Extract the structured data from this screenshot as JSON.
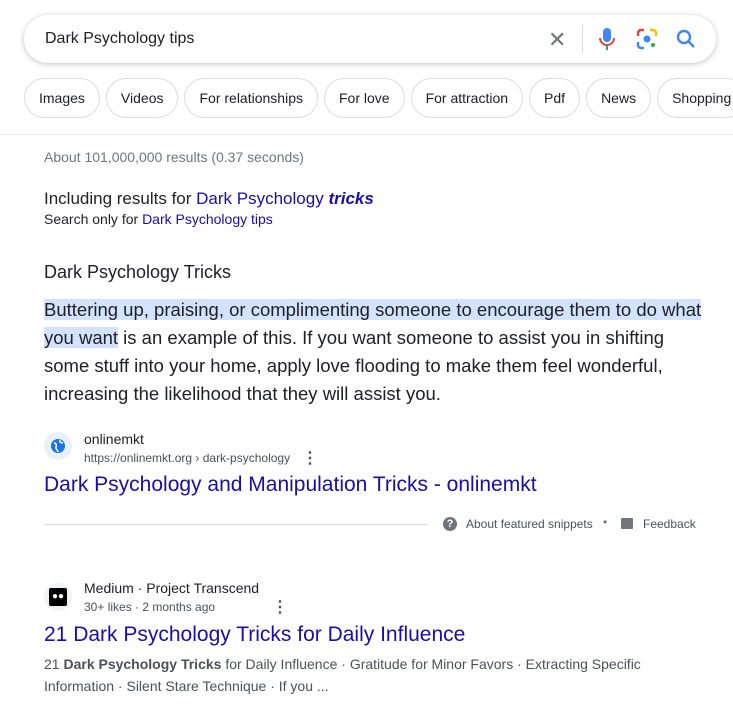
{
  "search": {
    "query": "Dark Psychology tips"
  },
  "chips": [
    "Images",
    "Videos",
    "For relationships",
    "For love",
    "For attraction",
    "Pdf",
    "News",
    "Shopping"
  ],
  "stats": "About 101,000,000 results (0.37 seconds)",
  "correction": {
    "including": "Including results for",
    "corrected_plain": "Dark Psychology",
    "corrected_bold": "tricks",
    "search_only": "Search only for",
    "original": "Dark Psychology tips"
  },
  "featured": {
    "heading": "Dark Psychology Tricks",
    "highlight": "Buttering up, praising, or complimenting someone to encourage them to do what you want",
    "rest": " is an example of this. If you want someone to assist you in shifting some stuff into your home, apply love flooding to make them feel wonderful, increasing the likelihood that they will assist you.",
    "site": "onlinemkt",
    "url": "https://onlinemkt.org › dark-psychology",
    "title": "Dark Psychology and Manipulation Tricks - onlinemkt",
    "about": "About featured snippets",
    "feedback": "Feedback"
  },
  "result2": {
    "site": "Medium · Project Transcend",
    "meta": "30+ likes · 2 months ago",
    "title": "21 Dark Psychology Tricks for Daily Influence",
    "snippet_pre": "21 ",
    "snippet_bold": "Dark Psychology Tricks",
    "snippet_post": " for Daily Influence · Gratitude for Minor Favors · Extracting Specific Information · Silent Stare Technique · If you ..."
  }
}
